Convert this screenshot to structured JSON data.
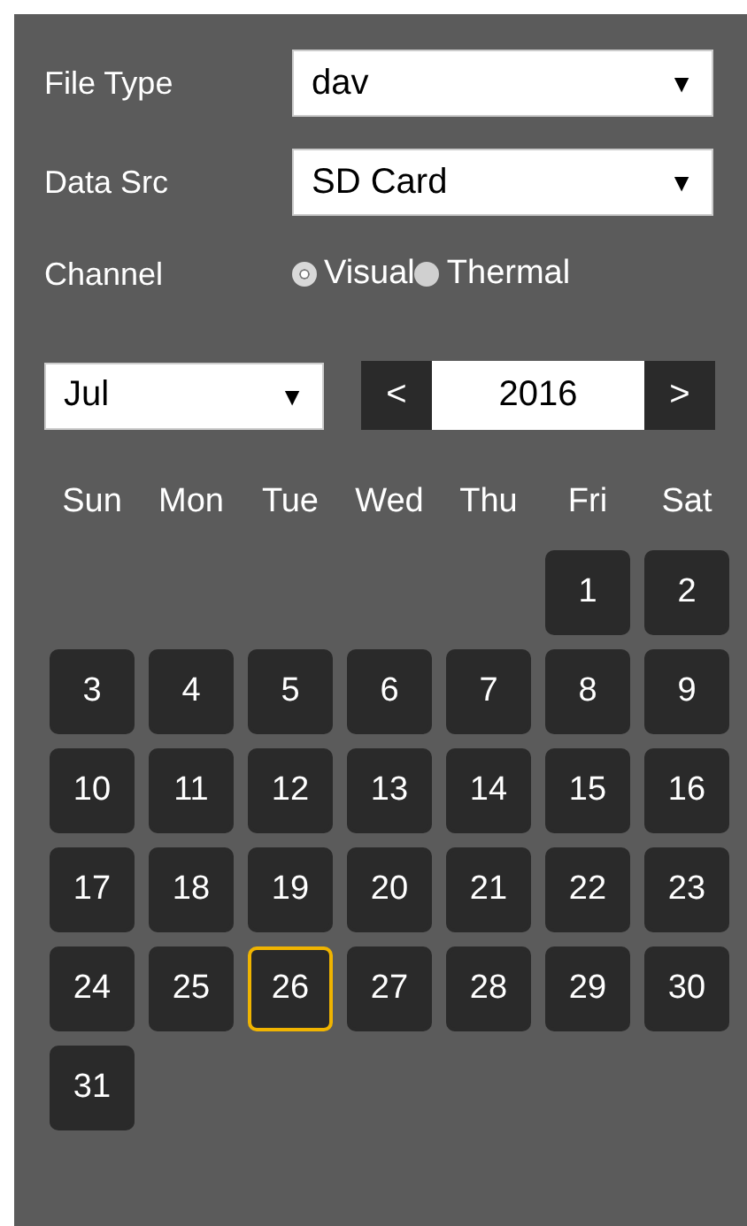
{
  "fields": [
    {
      "label": "File Type",
      "value": "dav",
      "caret": "▼"
    },
    {
      "label": "Data Src",
      "value": "SD Card",
      "caret": "▼"
    }
  ],
  "channel": {
    "label": "Channel",
    "options": [
      {
        "label": "Visual",
        "selected": true
      },
      {
        "label": "Thermal",
        "selected": false
      }
    ]
  },
  "month_select": {
    "value": "Jul",
    "caret": "▼"
  },
  "year": {
    "prev": "<",
    "value": "2016",
    "next": ">"
  },
  "weekdays": [
    "Sun",
    "Mon",
    "Tue",
    "Wed",
    "Thu",
    "Fri",
    "Sat"
  ],
  "weeks": [
    [
      {
        "label": "1",
        "selected": false
      },
      {
        "label": "2",
        "selected": false
      }
    ],
    [
      {
        "label": "3",
        "selected": false
      },
      {
        "label": "4",
        "selected": false
      },
      {
        "label": "5",
        "selected": false
      },
      {
        "label": "6",
        "selected": false
      },
      {
        "label": "7",
        "selected": false
      },
      {
        "label": "8",
        "selected": false
      },
      {
        "label": "9",
        "selected": false
      }
    ],
    [
      {
        "label": "10",
        "selected": false
      },
      {
        "label": "11",
        "selected": false
      },
      {
        "label": "12",
        "selected": false
      },
      {
        "label": "13",
        "selected": false
      },
      {
        "label": "14",
        "selected": false
      },
      {
        "label": "15",
        "selected": false
      },
      {
        "label": "16",
        "selected": false
      }
    ],
    [
      {
        "label": "17",
        "selected": false
      },
      {
        "label": "18",
        "selected": false
      },
      {
        "label": "19",
        "selected": false
      },
      {
        "label": "20",
        "selected": false
      },
      {
        "label": "21",
        "selected": false
      },
      {
        "label": "22",
        "selected": false
      },
      {
        "label": "23",
        "selected": false
      }
    ],
    [
      {
        "label": "24",
        "selected": false
      },
      {
        "label": "25",
        "selected": false
      },
      {
        "label": "26",
        "selected": true
      },
      {
        "label": "27",
        "selected": false
      },
      {
        "label": "28",
        "selected": false
      },
      {
        "label": "29",
        "selected": false
      },
      {
        "label": "30",
        "selected": false
      }
    ],
    [
      {
        "label": "31",
        "selected": false
      }
    ]
  ]
}
